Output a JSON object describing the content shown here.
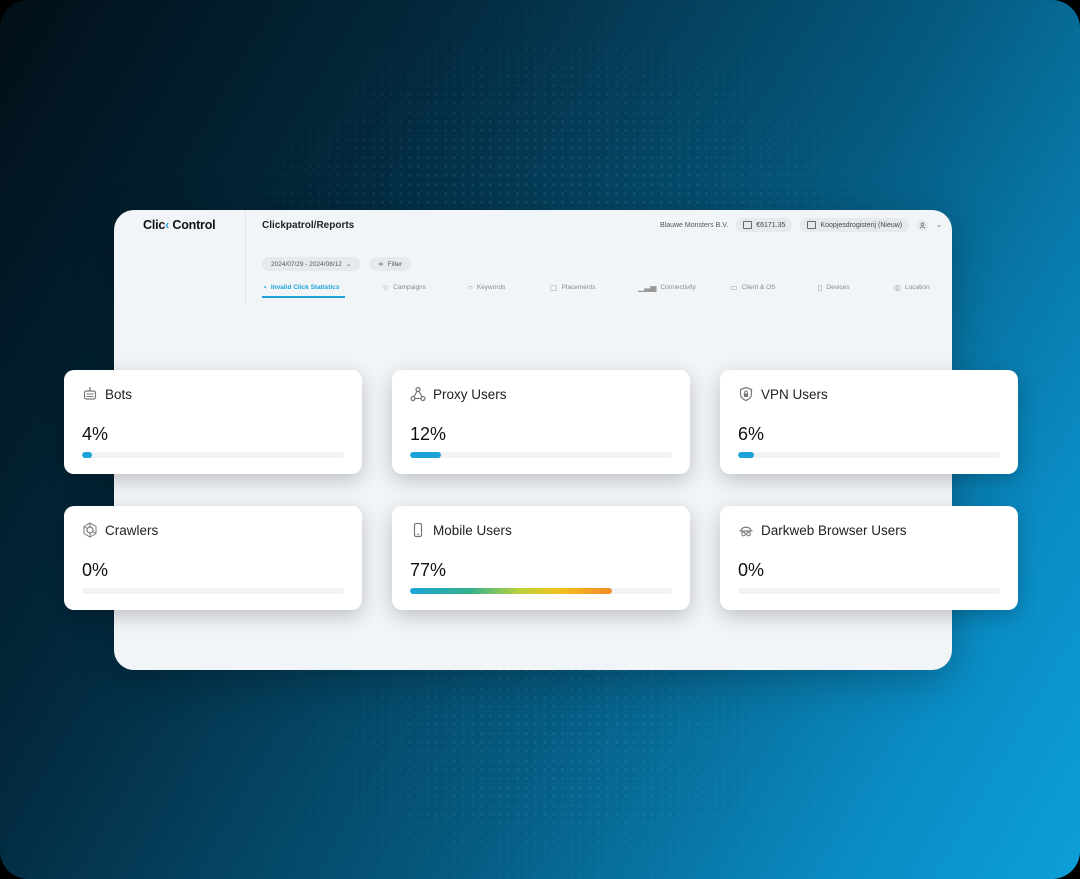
{
  "app": {
    "logo_left": "Clic",
    "logo_mid": "‹",
    "logo_right": "Control",
    "title": "Clickpatrol/Reports",
    "company": "Blauwe Monsters B.V.",
    "balance": "€6171.35",
    "account": "Koopjesdrogisterij (Nieuw)"
  },
  "filters": {
    "date_range": "2024/07/29 - 2024/08/12",
    "filter_label": "Filter"
  },
  "tabs": [
    {
      "label": "Invalid Click Statistics",
      "icon": "pie-icon",
      "active": true
    },
    {
      "label": "Campaigns",
      "icon": "campaign-icon",
      "active": false
    },
    {
      "label": "Keywords",
      "icon": "search-icon",
      "active": false
    },
    {
      "label": "Placements",
      "icon": "placement-icon",
      "active": false
    },
    {
      "label": "Connectivity",
      "icon": "signal-icon",
      "active": false
    },
    {
      "label": "Client & OS",
      "icon": "monitor-icon",
      "active": false
    },
    {
      "label": "Devices",
      "icon": "device-icon",
      "active": false
    },
    {
      "label": "Location",
      "icon": "pin-icon",
      "active": false
    }
  ],
  "cards": [
    {
      "title": "Bots",
      "value": "4%",
      "percent": 4,
      "icon": "robot-icon"
    },
    {
      "title": "Proxy Users",
      "value": "12%",
      "percent": 12,
      "icon": "network-icon"
    },
    {
      "title": "VPN Users",
      "value": "6%",
      "percent": 6,
      "icon": "lock-icon"
    },
    {
      "title": "Crawlers",
      "value": "0%",
      "percent": 0,
      "icon": "spider-icon"
    },
    {
      "title": "Mobile Users",
      "value": "77%",
      "percent": 77,
      "icon": "mobile-icon"
    },
    {
      "title": "Darkweb Browser Users",
      "value": "0%",
      "percent": 0,
      "icon": "spy-icon"
    }
  ],
  "colors": {
    "accent": "#1aa3d8",
    "gradient_stops": [
      "#1aa3d8",
      "#36b28a",
      "#bfd13a",
      "#f3c01d",
      "#f38a2b"
    ]
  }
}
